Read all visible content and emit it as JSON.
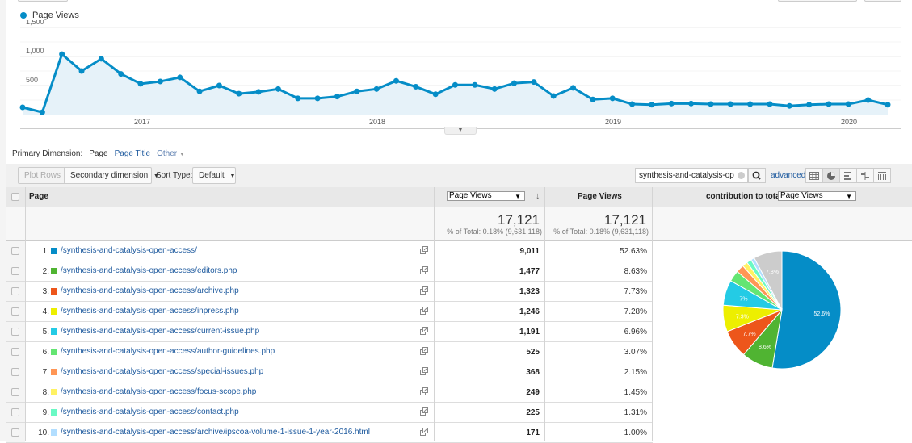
{
  "chart_data": {
    "type": "line",
    "title": "",
    "legend": [
      "Page Views"
    ],
    "legend_placement": "top-left",
    "series": [
      {
        "name": "Page Views",
        "color": "#058dc7",
        "values": [
          125,
          40,
          1040,
          750,
          960,
          700,
          530,
          570,
          640,
          400,
          500,
          360,
          390,
          440,
          280,
          280,
          310,
          400,
          440,
          580,
          480,
          350,
          510,
          510,
          440,
          540,
          560,
          320,
          460,
          260,
          280,
          180,
          170,
          190,
          190,
          180,
          180,
          180,
          180,
          150,
          170,
          180,
          180,
          250,
          170
        ]
      }
    ],
    "x_ticks": [
      "2017",
      "2018",
      "2019",
      "2020"
    ],
    "y_ticks": [
      "500",
      "1,000",
      "1,500"
    ],
    "ylim": [
      0,
      1500
    ],
    "grid": true
  },
  "pie_data": {
    "type": "pie",
    "slices": [
      {
        "label": "52.6%",
        "value": 52.63,
        "color": "#058dc7"
      },
      {
        "label": "8.6%",
        "value": 8.63,
        "color": "#50b432"
      },
      {
        "label": "7.7%",
        "value": 7.73,
        "color": "#ed561b"
      },
      {
        "label": "7.3%",
        "value": 7.28,
        "color": "#edef00"
      },
      {
        "label": "7%",
        "value": 6.96,
        "color": "#24cbe5"
      },
      {
        "label": "",
        "value": 3.07,
        "color": "#64e572"
      },
      {
        "label": "",
        "value": 2.15,
        "color": "#ff9655"
      },
      {
        "label": "",
        "value": 1.45,
        "color": "#fff263"
      },
      {
        "label": "",
        "value": 1.31,
        "color": "#6af9c4"
      },
      {
        "label": "",
        "value": 1.0,
        "color": "#b2deff"
      },
      {
        "label": "7.8%",
        "value": 7.79,
        "color": "#cccccc"
      }
    ]
  },
  "legend_label": "Page Views",
  "primary_dimension": {
    "label": "Primary Dimension:",
    "active": "Page",
    "options": [
      "Page Title",
      "Other"
    ]
  },
  "toolbar": {
    "plot_rows": "Plot Rows",
    "secondary_dimension": "Secondary dimension",
    "sort_type_label": "Sort Type:",
    "sort_type_value": "Default",
    "search_value": "synthesis-and-catalysis-op",
    "advanced": "advanced"
  },
  "table": {
    "col_page": "Page",
    "col_metric_select": "Page Views",
    "col_metric2": "Page Views",
    "contribution_label": "contribution to total:",
    "contribution_select": "Page Views",
    "total_value": "17,121",
    "total_pct": "% of Total: 0.18% (9,631,118)",
    "total_value2": "17,121",
    "total_pct2": "% of Total: 0.18% (9,631,118)",
    "rows": [
      {
        "idx": "1.",
        "page": "/synthesis-and-catalysis-open-access/",
        "views": "9,011",
        "pct": "52.63%",
        "color": "#058dc7"
      },
      {
        "idx": "2.",
        "page": "/synthesis-and-catalysis-open-access/editors.php",
        "views": "1,477",
        "pct": "8.63%",
        "color": "#50b432"
      },
      {
        "idx": "3.",
        "page": "/synthesis-and-catalysis-open-access/archive.php",
        "views": "1,323",
        "pct": "7.73%",
        "color": "#ed561b"
      },
      {
        "idx": "4.",
        "page": "/synthesis-and-catalysis-open-access/inpress.php",
        "views": "1,246",
        "pct": "7.28%",
        "color": "#edef00"
      },
      {
        "idx": "5.",
        "page": "/synthesis-and-catalysis-open-access/current-issue.php",
        "views": "1,191",
        "pct": "6.96%",
        "color": "#24cbe5"
      },
      {
        "idx": "6.",
        "page": "/synthesis-and-catalysis-open-access/author-guidelines.php",
        "views": "525",
        "pct": "3.07%",
        "color": "#64e572"
      },
      {
        "idx": "7.",
        "page": "/synthesis-and-catalysis-open-access/special-issues.php",
        "views": "368",
        "pct": "2.15%",
        "color": "#ff9655"
      },
      {
        "idx": "8.",
        "page": "/synthesis-and-catalysis-open-access/focus-scope.php",
        "views": "249",
        "pct": "1.45%",
        "color": "#fff263"
      },
      {
        "idx": "9.",
        "page": "/synthesis-and-catalysis-open-access/contact.php",
        "views": "225",
        "pct": "1.31%",
        "color": "#6af9c4"
      },
      {
        "idx": "10.",
        "page": "/synthesis-and-catalysis-open-access/archive/ipscoa-volume-1-issue-1-year-2016.html",
        "views": "171",
        "pct": "1.00%",
        "color": "#b2deff"
      }
    ]
  }
}
